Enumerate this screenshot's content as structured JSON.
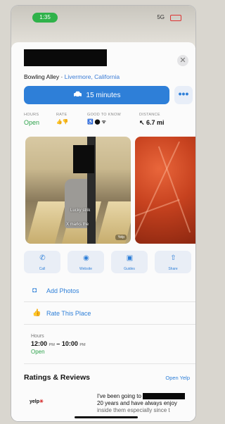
{
  "status_bar": {
    "time": "1:35",
    "signal": "5G"
  },
  "place": {
    "category": "Bowling Alley",
    "separator": " · ",
    "location": "Livermore, California"
  },
  "directions": {
    "label": "15 minutes",
    "more": "•••"
  },
  "stats": {
    "hours": {
      "label": "HOURS",
      "value": "Open"
    },
    "rate": {
      "label": "RATE",
      "value": "👍👎"
    },
    "good_to_know": {
      "label": "GOOD TO KNOW",
      "value": "♿ ⬤ ᯤ"
    },
    "distance": {
      "label": "DISTANCE",
      "value": "↖ 6.7 mi"
    }
  },
  "photos": {
    "caption1": "Lucky strik",
    "caption2": "X marks the",
    "source": "Yelp"
  },
  "actions": [
    {
      "label": "Call",
      "icon": "phone-icon",
      "glyph": "✆"
    },
    {
      "label": "Website",
      "icon": "compass-icon",
      "glyph": "◉"
    },
    {
      "label": "Guides",
      "icon": "guides-icon",
      "glyph": "▣"
    },
    {
      "label": "Share",
      "icon": "share-icon",
      "glyph": "⇧"
    }
  ],
  "rows": {
    "add_photos": {
      "label": "Add Photos",
      "icon": "camera-icon",
      "glyph": "◘"
    },
    "rate_place": {
      "label": "Rate This Place",
      "icon": "thumbs-up-icon",
      "glyph": "👍"
    }
  },
  "hours": {
    "label": "Hours",
    "open_time": "12:00",
    "open_ampm": "PM",
    "dash": " – ",
    "close_time": "10:00",
    "close_ampm": "PM",
    "status": "Open"
  },
  "reviews": {
    "heading": "Ratings & Reviews",
    "open_link": "Open Yelp",
    "source": "yelp",
    "line1": "I've been going to",
    "line2": "20 years and have always enjoy",
    "line3": "inside them especially since t"
  },
  "colors": {
    "accent": "#2e7fd8",
    "open": "#2ea34c",
    "yelp": "#d32323"
  }
}
